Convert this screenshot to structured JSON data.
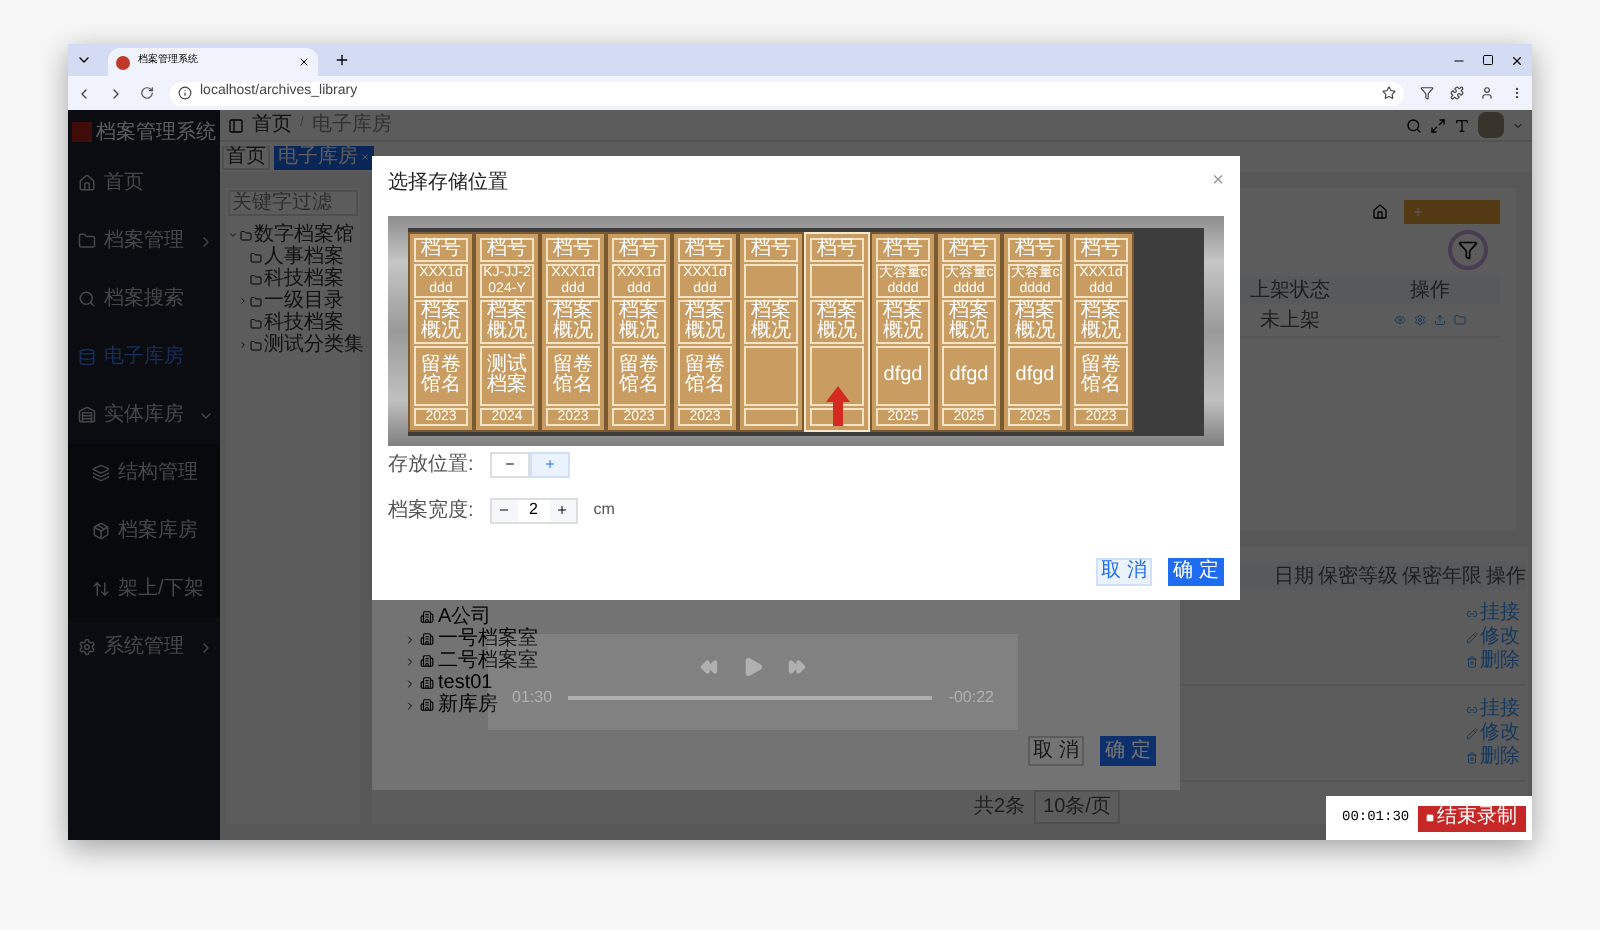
{
  "browser": {
    "tab_title": "档案管理系统",
    "url": "localhost/archives_library"
  },
  "sidebar": {
    "logo": "档案管理系统",
    "items": [
      {
        "label": "首页",
        "selected": false
      },
      {
        "label": "档案管理",
        "selected": false,
        "expanded": false
      },
      {
        "label": "档案搜索",
        "selected": false
      },
      {
        "label": "电子库房",
        "selected": true
      },
      {
        "label": "实体库房",
        "selected": false,
        "expanded": true,
        "children": [
          {
            "label": "结构管理",
            "selected": false
          },
          {
            "label": "档案库房",
            "selected": false
          },
          {
            "label": "架上/下架",
            "selected": false
          }
        ]
      },
      {
        "label": "系统管理",
        "selected": false,
        "expanded": false
      }
    ]
  },
  "header": {
    "breadcrumb": [
      "首页",
      "电子库房"
    ],
    "separator": "/"
  },
  "tags": [
    {
      "label": "首页",
      "selected": false
    },
    {
      "label": "电子库房",
      "selected": true
    }
  ],
  "archive_tree": {
    "placeholder": "关键字过滤",
    "nodes": [
      {
        "label": "数字档案馆",
        "expanded": true,
        "children": [
          {
            "label": "人事档案"
          },
          {
            "label": "科技档案"
          },
          {
            "label": "一级目录",
            "expanded": false
          },
          {
            "label": "科技档案"
          },
          {
            "label": "测试分类集",
            "expanded": false
          }
        ]
      }
    ]
  },
  "upper_table": {
    "columns": [
      "上架状态",
      "操作"
    ],
    "rows": [
      {
        "status": "未上架"
      }
    ]
  },
  "lower_table": {
    "columns": [
      "日期",
      "保密等级",
      "保密年限",
      "操作"
    ],
    "rows": [
      {
        "actions": [
          "挂接",
          "修改",
          "删除"
        ]
      },
      {
        "actions": [
          "挂接",
          "修改",
          "删除"
        ]
      }
    ],
    "total": "共2条",
    "page_size": "10条/页"
  },
  "location_dialog": {
    "items": [
      {
        "label": "A公司"
      },
      {
        "label": "一号档案室",
        "expanded": false
      },
      {
        "label": "二号档案室",
        "expanded": false
      },
      {
        "label": "test01",
        "expanded": false
      },
      {
        "label": "新库房",
        "expanded": false
      }
    ],
    "buttons": [
      "取 消",
      "确 定"
    ]
  },
  "storage_dialog": {
    "title": "选择存储位置",
    "close": "×",
    "boxes": [
      {
        "top_label": "档号",
        "code": "XXX1dddd",
        "mid_label": "档案概况",
        "name": "留卷馆名",
        "year": "2023",
        "selected": false
      },
      {
        "top_label": "档号",
        "code": "KJ-JJ-2024-Y",
        "mid_label": "档案概况",
        "name": "测试档案",
        "year": "2024",
        "selected": false
      },
      {
        "top_label": "档号",
        "code": "XXX1dddd",
        "mid_label": "档案概况",
        "name": "留卷馆名",
        "year": "2023",
        "selected": false
      },
      {
        "top_label": "档号",
        "code": "XXX1dddd",
        "mid_label": "档案概况",
        "name": "留卷馆名",
        "year": "2023",
        "selected": false
      },
      {
        "top_label": "档号",
        "code": "XXX1dddd",
        "mid_label": "档案概况",
        "name": "留卷馆名",
        "year": "2023",
        "selected": false
      },
      {
        "top_label": "档号",
        "mid_label": "档案概况",
        "selected": false
      },
      {
        "top_label": "档号",
        "mid_label": "档案概况",
        "selected": true
      },
      {
        "top_label": "档号",
        "code": "大容量cdddd",
        "mid_label": "档案概况",
        "name": "dfgd",
        "year": "2025",
        "selected": false
      },
      {
        "top_label": "档号",
        "code": "大容量cdddd",
        "mid_label": "档案概况",
        "name": "dfgd",
        "year": "2025",
        "selected": false
      },
      {
        "top_label": "档号",
        "code": "大容量cdddd",
        "mid_label": "档案概况",
        "name": "dfgd",
        "year": "2025",
        "selected": false
      },
      {
        "top_label": "档号",
        "code": "XXX1dddd",
        "mid_label": "档案概况",
        "name": "留卷馆名",
        "year": "2023",
        "selected": false
      }
    ],
    "position_label": "存放位置:",
    "width_label": "档案宽度:",
    "width_value": "2",
    "width_unit": "cm",
    "buttons": [
      "取 消",
      "确 定"
    ]
  },
  "player": {
    "elapsed": "01:30",
    "remaining": "-00:22"
  },
  "recorder": {
    "time": "00:01:30",
    "stop": "结束录制"
  }
}
